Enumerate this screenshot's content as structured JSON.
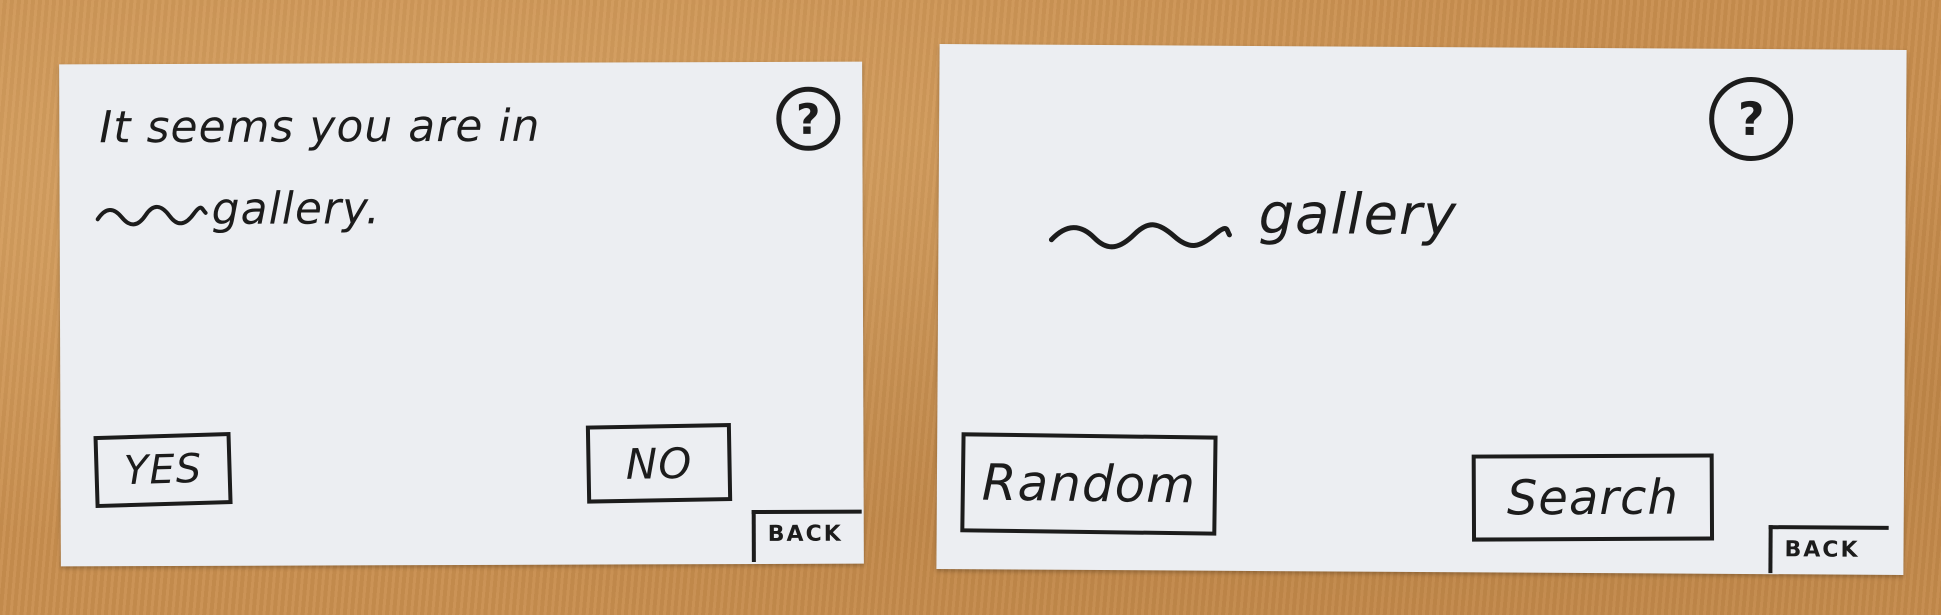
{
  "screen_confirm": {
    "prompt_line1": "It seems you are in",
    "prompt_line2": "gallery.",
    "help_label": "?",
    "yes_label": "YES",
    "no_label": "NO",
    "back_label": "BACK"
  },
  "screen_gallery": {
    "title": "gallery",
    "help_label": "?",
    "random_label": "Random",
    "search_label": "Search",
    "back_label": "BACK"
  },
  "colors": {
    "ink": "#1c1c1c",
    "paper": "#eceef2",
    "table": "#c98f4f"
  },
  "icons": [
    "help-icon",
    "placeholder-squiggle"
  ]
}
